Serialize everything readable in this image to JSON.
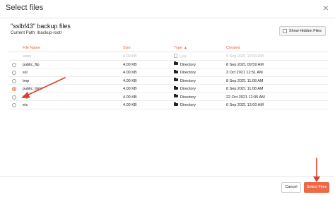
{
  "dialog": {
    "title": "Select files",
    "close_glyph": "×"
  },
  "panel": {
    "title": "\"sslbf43\" backup files",
    "path_label": "Current Path:",
    "path_value": "/backup-root/"
  },
  "actions": {
    "show_hidden_label": "Show Hidden Files",
    "cancel_label": "Cancel",
    "select_label": "Select Files"
  },
  "table": {
    "headers": {
      "name": "File Name",
      "size": "Size",
      "type": "Type",
      "type_sort_glyph": "▲",
      "created": "Created"
    },
    "rows": [
      {
        "name": "www",
        "size": "4.00 KB",
        "type": "Link",
        "created": "6 Sep 2021 12:00 AM"
      },
      {
        "name": "public_ftp",
        "size": "4.00 KB",
        "type": "Directory",
        "created": "8 Sep 2021 09:59 AM"
      },
      {
        "name": "ssl",
        "size": "4.00 KB",
        "type": "Directory",
        "created": "3 Oct 2021 12:51 AM"
      },
      {
        "name": "tmp",
        "size": "4.00 KB",
        "type": "Directory",
        "created": "8 Sep 2021 11:08 AM"
      },
      {
        "name": "public_html",
        "size": "4.00 KB",
        "type": "Directory",
        "created": "8 Sep 2021 11:08 AM"
      },
      {
        "name": "logs",
        "size": "4.00 KB",
        "type": "Directory",
        "created": "22 Oct 2021 12:05 AM"
      },
      {
        "name": "etc",
        "size": "4.00 KB",
        "type": "Directory",
        "created": "6 Sep 2021 12:00 AM"
      }
    ]
  },
  "colors": {
    "accent": "#ee6a45",
    "annotation_arrow": "#e23b2b"
  },
  "icons": {
    "directory": "folder-icon",
    "link": "link-icon"
  }
}
